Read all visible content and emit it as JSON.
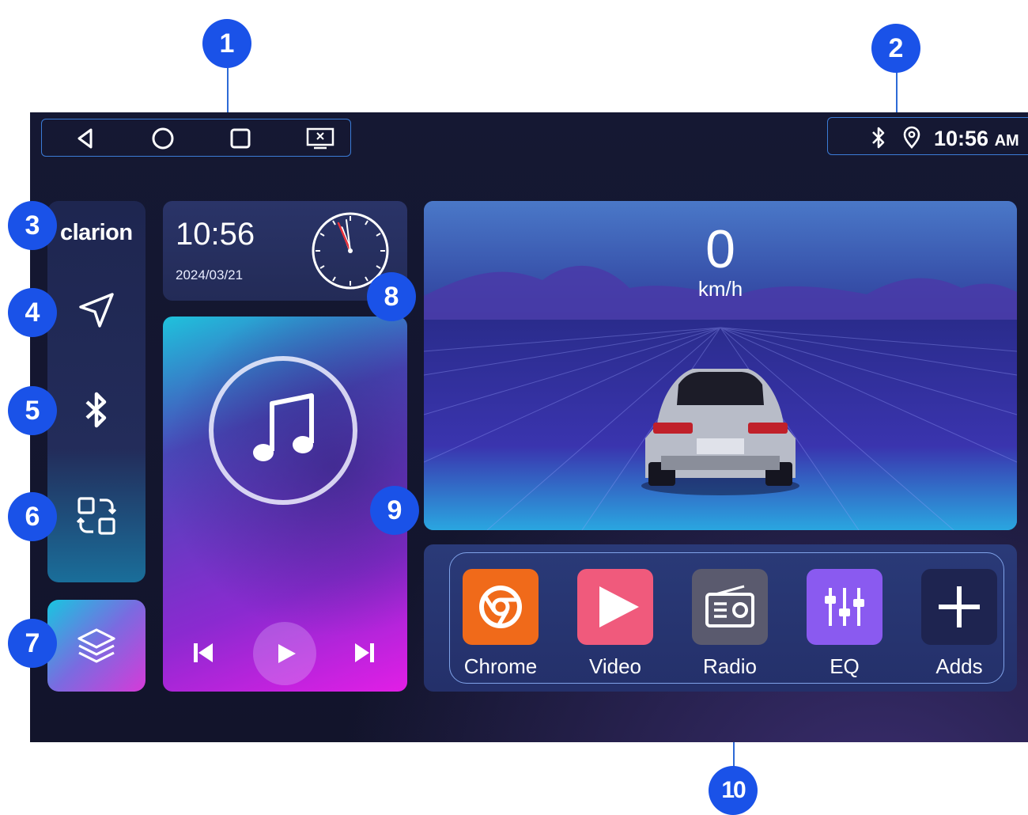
{
  "status_bar": {
    "nav_buttons": [
      "back-icon",
      "home-icon",
      "recents-icon",
      "screen-off-icon"
    ],
    "time": "10:56",
    "time_suffix": "AM",
    "icons": [
      "bluetooth-icon",
      "location-icon"
    ]
  },
  "sidebar": {
    "logo": "clarion",
    "items": [
      "navigation-icon",
      "bluetooth-icon",
      "app-switch-icon"
    ],
    "layers_button": "layers-icon"
  },
  "clock_widget": {
    "time": "10:56",
    "date": "2024/03/21"
  },
  "music_widget": {
    "controls": [
      "previous-icon",
      "play-icon",
      "next-icon"
    ]
  },
  "speed_widget": {
    "value": "0",
    "unit": "km/h"
  },
  "apps": [
    {
      "label": "Chrome",
      "icon": "chrome-icon",
      "color": "#f06a1a"
    },
    {
      "label": "Video",
      "icon": "video-icon",
      "color": "#f05a7c"
    },
    {
      "label": "Radio",
      "icon": "radio-icon",
      "color": "#5a5a6e"
    },
    {
      "label": "EQ",
      "icon": "eq-icon",
      "color": "#8a5af0"
    },
    {
      "label": "Adds",
      "icon": "add-icon",
      "color": "#1e2450"
    }
  ],
  "callouts": [
    "1",
    "2",
    "3",
    "4",
    "5",
    "6",
    "7",
    "8",
    "9",
    "10"
  ],
  "colors": {
    "callout_blue": "#1a52e8",
    "outline_blue": "#3b7bd6",
    "screen_bg": "#151833"
  }
}
